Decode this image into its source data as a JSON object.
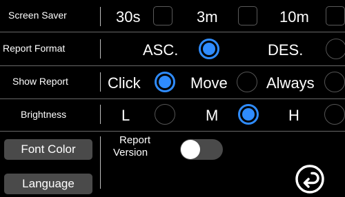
{
  "screen_saver": {
    "label": "Screen Saver",
    "options": [
      "30s",
      "3m",
      "10m"
    ]
  },
  "report_format": {
    "label": "Report Format",
    "options": [
      "ASC.",
      "DES."
    ],
    "selected": "ASC."
  },
  "show_report": {
    "label": "Show Report",
    "options": [
      "Click",
      "Move",
      "Always"
    ],
    "selected": "Click"
  },
  "brightness": {
    "label": "Brightness",
    "options": [
      "L",
      "M",
      "H"
    ],
    "selected": "M"
  },
  "buttons": {
    "font_color": "Font Color",
    "language": "Language"
  },
  "report_version": {
    "line1": "Report",
    "line2": "Version",
    "on": false
  },
  "colors": {
    "accent": "#2f8cff",
    "background": "#000000",
    "button": "#4a4a4a"
  },
  "icons": {
    "return": "return-arrow-icon"
  }
}
